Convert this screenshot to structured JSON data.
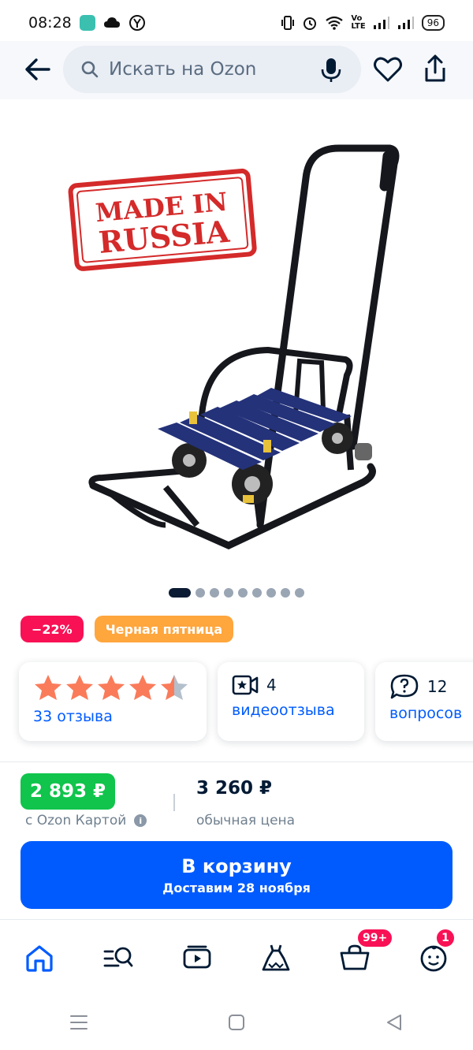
{
  "status_bar": {
    "time": "08:28",
    "battery": "96",
    "network_label": "Vo\nLTE"
  },
  "header": {
    "search_placeholder": "Искать на Ozon"
  },
  "product_image": {
    "stamp_line1": "MADE IN",
    "stamp_line2": "RUSSIA",
    "image_count": 9,
    "active_index": 0
  },
  "badges": {
    "discount": "−22%",
    "promo": "Черная пятница"
  },
  "stats": {
    "rating": 4.5,
    "reviews_label": "33 отзыва",
    "video_count": "4",
    "video_label": "видеоотзыва",
    "questions_count": "12",
    "questions_label": "вопросов"
  },
  "price": {
    "card_price": "2 893 ₽",
    "card_label": "с Ozon Картой",
    "regular_price": "3 260 ₽",
    "regular_label": "обычная цена"
  },
  "cart_button": {
    "title": "В корзину",
    "subtitle": "Доставим 28 ноября"
  },
  "bottom_nav": {
    "cart_badge": "99+",
    "profile_badge": "1"
  },
  "colors": {
    "accent": "#005bff",
    "sale": "#f91155",
    "promo": "#ffa63d",
    "price_green": "#10c44c"
  }
}
